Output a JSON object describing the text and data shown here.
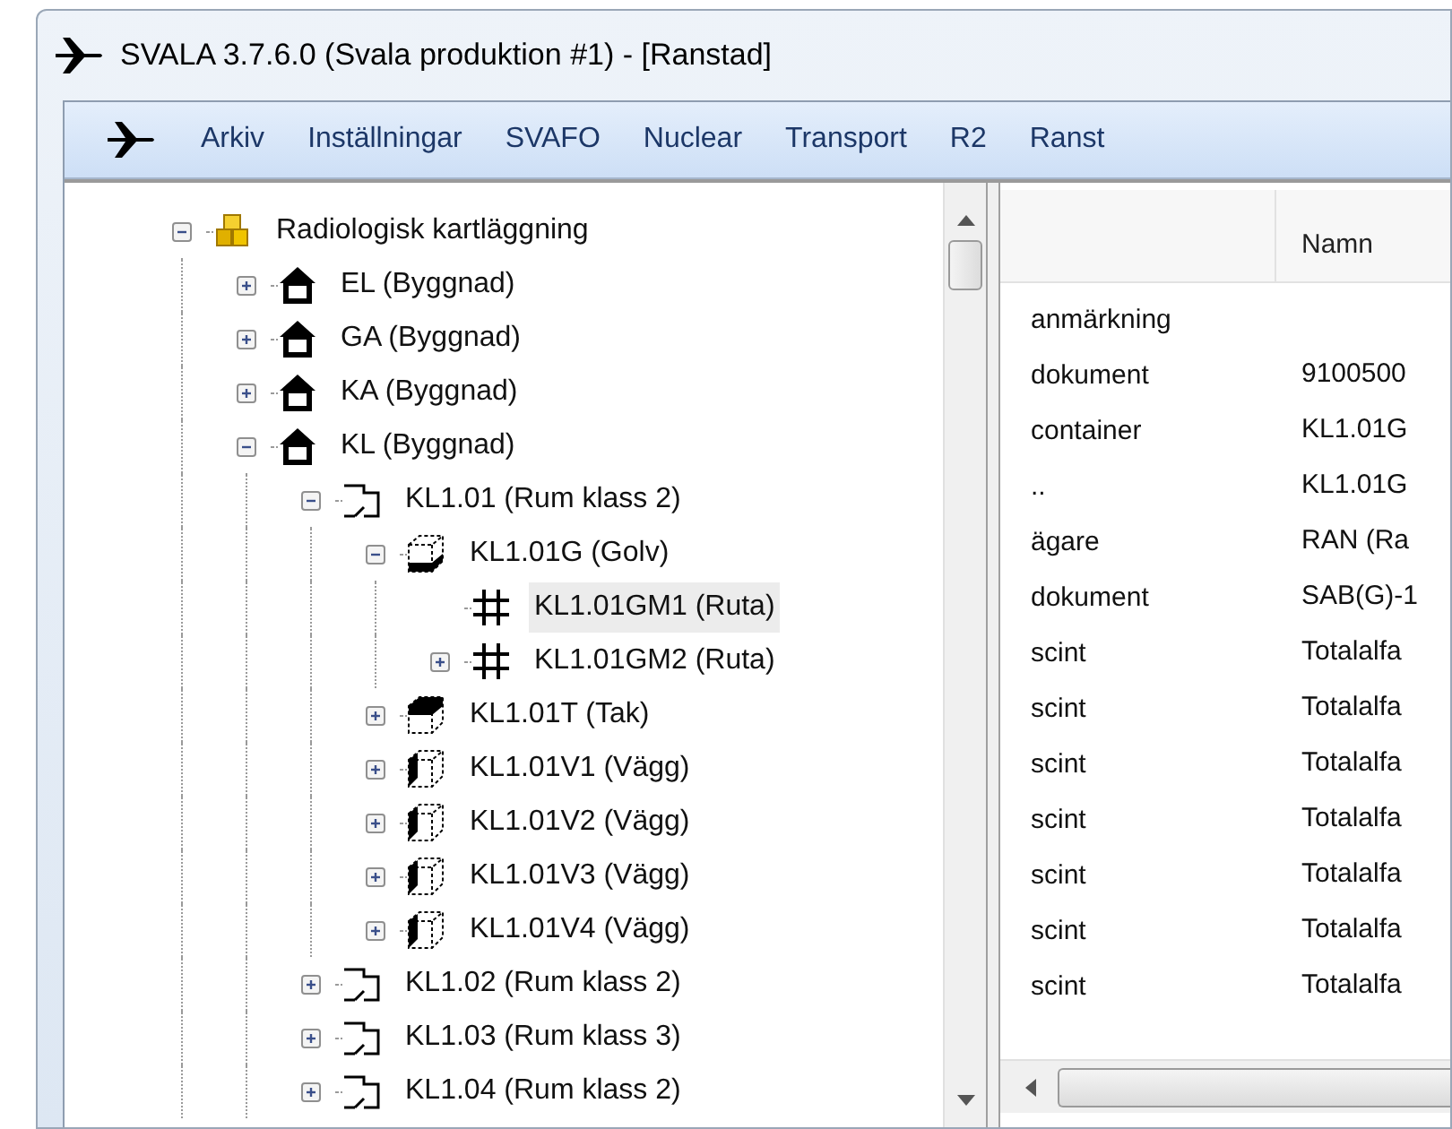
{
  "window": {
    "title": "SVALA 3.7.6.0 (Svala produktion #1) - [Ranstad]"
  },
  "menu": [
    "Arkiv",
    "Inställningar",
    "SVAFO",
    "Nuclear",
    "Transport",
    "R2",
    "Ranst"
  ],
  "tree": [
    {
      "label": "Radiologisk kartläggning",
      "kind": "group",
      "expanded": true,
      "selected": false,
      "children": [
        {
          "label": "EL (Byggnad)",
          "kind": "building",
          "expanded": false,
          "selected": false
        },
        {
          "label": "GA (Byggnad)",
          "kind": "building",
          "expanded": false,
          "selected": false
        },
        {
          "label": "KA (Byggnad)",
          "kind": "building",
          "expanded": false,
          "selected": false
        },
        {
          "label": "KL (Byggnad)",
          "kind": "building",
          "expanded": true,
          "selected": false,
          "children": [
            {
              "label": "KL1.01 (Rum klass 2)",
              "kind": "room",
              "expanded": true,
              "selected": false,
              "children": [
                {
                  "label": "KL1.01G (Golv)",
                  "kind": "floor",
                  "expanded": true,
                  "selected": false,
                  "children": [
                    {
                      "label": "KL1.01GM1 (Ruta)",
                      "kind": "grid",
                      "selected": true
                    },
                    {
                      "label": "KL1.01GM2 (Ruta)",
                      "kind": "grid",
                      "expanded": false,
                      "selected": false
                    }
                  ]
                },
                {
                  "label": "KL1.01T (Tak)",
                  "kind": "ceiling",
                  "expanded": false,
                  "selected": false
                },
                {
                  "label": "KL1.01V1 (Vägg)",
                  "kind": "wall",
                  "expanded": false,
                  "selected": false
                },
                {
                  "label": "KL1.01V2 (Vägg)",
                  "kind": "wall",
                  "expanded": false,
                  "selected": false
                },
                {
                  "label": "KL1.01V3 (Vägg)",
                  "kind": "wall",
                  "expanded": false,
                  "selected": false
                },
                {
                  "label": "KL1.01V4 (Vägg)",
                  "kind": "wall",
                  "expanded": false,
                  "selected": false
                }
              ]
            },
            {
              "label": "KL1.02 (Rum klass 2)",
              "kind": "room",
              "expanded": false,
              "selected": false
            },
            {
              "label": "KL1.03 (Rum klass 3)",
              "kind": "room",
              "expanded": false,
              "selected": false
            },
            {
              "label": "KL1.04 (Rum klass 2)",
              "kind": "room",
              "expanded": false,
              "selected": false
            }
          ]
        }
      ]
    }
  ],
  "table": {
    "columns": [
      "",
      "Namn"
    ],
    "rows": [
      [
        "anmärkning",
        ""
      ],
      [
        "dokument",
        "9100500"
      ],
      [
        "container",
        "KL1.01G"
      ],
      [
        "..",
        "KL1.01G"
      ],
      [
        "ägare",
        "RAN (Ra"
      ],
      [
        "dokument",
        "SAB(G)-1"
      ],
      [
        "scint",
        "Totalalfa"
      ],
      [
        "scint",
        "Totalalfa"
      ],
      [
        "scint",
        "Totalalfa"
      ],
      [
        "scint",
        "Totalalfa"
      ],
      [
        "scint",
        "Totalalfa"
      ],
      [
        "scint",
        "Totalalfa"
      ],
      [
        "scint",
        "Totalalfa"
      ]
    ]
  }
}
